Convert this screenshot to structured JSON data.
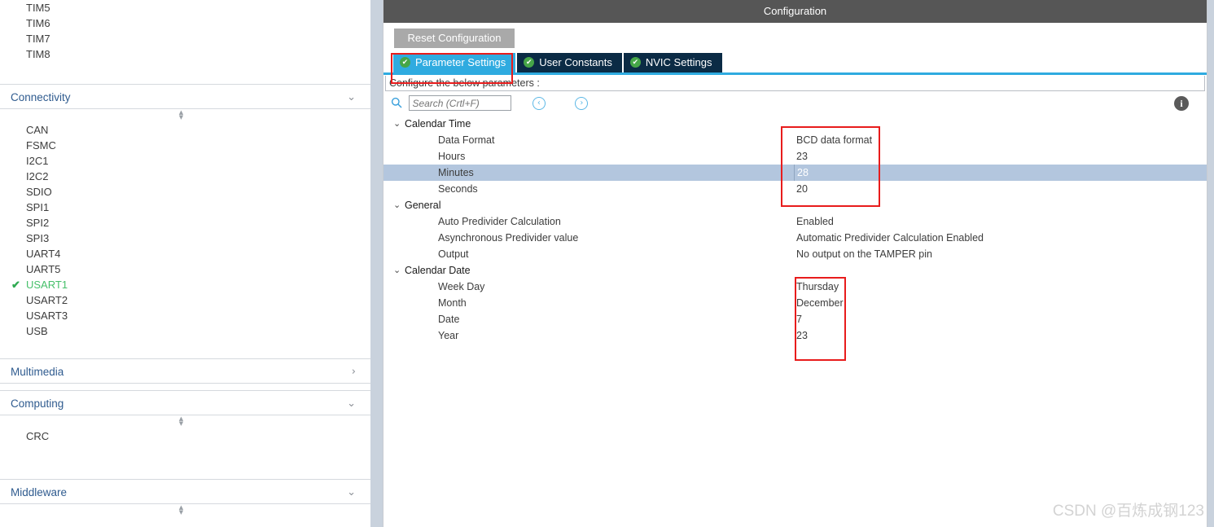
{
  "sidebar": {
    "top_items": [
      {
        "label": "TIM5",
        "enabled": false
      },
      {
        "label": "TIM6",
        "enabled": false
      },
      {
        "label": "TIM7",
        "enabled": false
      },
      {
        "label": "TIM8",
        "enabled": false
      }
    ],
    "sections": [
      {
        "title": "Connectivity",
        "chevron": "chevron-down-icon",
        "chevron_glyph": "⌄",
        "expanded": true,
        "items": [
          {
            "label": "CAN",
            "enabled": false
          },
          {
            "label": "FSMC",
            "enabled": false
          },
          {
            "label": "I2C1",
            "enabled": false
          },
          {
            "label": "I2C2",
            "enabled": false
          },
          {
            "label": "SDIO",
            "enabled": false
          },
          {
            "label": "SPI1",
            "enabled": false
          },
          {
            "label": "SPI2",
            "enabled": false
          },
          {
            "label": "SPI3",
            "enabled": false
          },
          {
            "label": "UART4",
            "enabled": false
          },
          {
            "label": "UART5",
            "enabled": false
          },
          {
            "label": "USART1",
            "enabled": true
          },
          {
            "label": "USART2",
            "enabled": false
          },
          {
            "label": "USART3",
            "enabled": false
          },
          {
            "label": "USB",
            "enabled": false
          }
        ]
      },
      {
        "title": "Multimedia",
        "chevron": "chevron-right-icon",
        "chevron_glyph": "›",
        "expanded": false,
        "items": []
      },
      {
        "title": "Computing",
        "chevron": "chevron-down-icon",
        "chevron_glyph": "⌄",
        "expanded": true,
        "items": [
          {
            "label": "CRC",
            "enabled": false
          }
        ]
      },
      {
        "title": "Middleware",
        "chevron": "chevron-down-icon",
        "chevron_glyph": "⌄",
        "expanded": true,
        "items": []
      }
    ],
    "check_glyph": "✔"
  },
  "config": {
    "title": "Configuration",
    "reset_label": "Reset Configuration",
    "tabs": [
      {
        "label": "Parameter Settings",
        "active": true,
        "status_icon": "check-circle-icon"
      },
      {
        "label": "User Constants",
        "active": false,
        "status_icon": "check-circle-icon"
      },
      {
        "label": "NVIC Settings",
        "active": false,
        "status_icon": "check-circle-icon"
      }
    ],
    "tab_check_glyph": "✔",
    "configure_text": "Configure the below parameters :",
    "search": {
      "placeholder": "Search (Crtl+F)",
      "value": "",
      "icon": "search-icon"
    },
    "nav_prev_glyph": "‹",
    "nav_next_glyph": "›",
    "info_glyph": "i",
    "twisty_expanded_glyph": "⌄",
    "groups": [
      {
        "name": "Calendar Time",
        "rows": [
          {
            "label": "Data Format",
            "value": "BCD data format",
            "selected": false
          },
          {
            "label": "Hours",
            "value": "23",
            "selected": false
          },
          {
            "label": "Minutes",
            "value": "28",
            "selected": true
          },
          {
            "label": "Seconds",
            "value": "20",
            "selected": false
          }
        ]
      },
      {
        "name": "General",
        "rows": [
          {
            "label": "Auto Predivider Calculation",
            "value": "Enabled",
            "selected": false
          },
          {
            "label": "Asynchronous Predivider value",
            "value": "Automatic Predivider Calculation Enabled",
            "selected": false
          },
          {
            "label": "Output",
            "value": "No output on the TAMPER pin",
            "selected": false
          }
        ]
      },
      {
        "name": "Calendar Date",
        "rows": [
          {
            "label": "Week Day",
            "value": "Thursday",
            "selected": false
          },
          {
            "label": "Month",
            "value": "December",
            "selected": false
          },
          {
            "label": "Date",
            "value": "7",
            "selected": false
          },
          {
            "label": "Year",
            "value": "23",
            "selected": false
          }
        ]
      }
    ]
  },
  "annotations": {
    "box_color": "#e81c1c",
    "boxes": [
      "parameter-settings-tab",
      "calendar-time-values",
      "calendar-date-values"
    ]
  },
  "watermark": {
    "text": "CSDN @百炼成钢123"
  }
}
